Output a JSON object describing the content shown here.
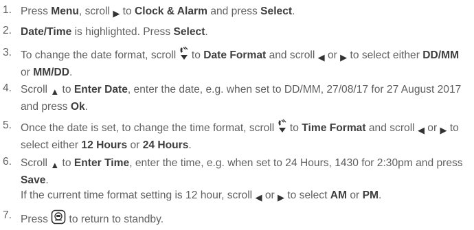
{
  "steps": [
    {
      "number": "1.",
      "parts": [
        {
          "t": "Press "
        },
        {
          "t": "Menu",
          "b": true
        },
        {
          "t": ", scroll "
        },
        {
          "icon": "right-arrow-icon",
          "g": "▶"
        },
        {
          "t": " to "
        },
        {
          "t": "Clock & Alarm",
          "b": true
        },
        {
          "t": " and press "
        },
        {
          "t": "Select",
          "b": true
        },
        {
          "t": "."
        }
      ]
    },
    {
      "number": "2.",
      "parts": [
        {
          "t": "Date/Time",
          "b": true
        },
        {
          "t": " is highlighted. Press "
        },
        {
          "t": "Select",
          "b": true
        },
        {
          "t": "."
        }
      ]
    },
    {
      "number": "3.",
      "parts": [
        {
          "t": "To change the date format, scroll "
        },
        {
          "icon": "phone-scroll-down-icon"
        },
        {
          "t": " to "
        },
        {
          "t": "Date Format",
          "b": true
        },
        {
          "t": " and scroll "
        },
        {
          "icon": "left-arrow-icon",
          "g": "◀"
        },
        {
          "t": " or "
        },
        {
          "icon": "right-arrow-icon",
          "g": "▶"
        },
        {
          "t": " to select either "
        },
        {
          "t": "DD/MM",
          "b": true
        },
        {
          "t": " or "
        },
        {
          "t": "MM/DD",
          "b": true
        },
        {
          "t": "."
        }
      ]
    },
    {
      "number": "4.",
      "parts": [
        {
          "t": "Scroll "
        },
        {
          "icon": "up-arrow-icon",
          "g": "▲"
        },
        {
          "t": " to "
        },
        {
          "t": "Enter Date",
          "b": true
        },
        {
          "t": ", enter the date, e.g. when set to DD/MM, 27/08/17 for 27 August 2017 and press "
        },
        {
          "t": "Ok",
          "b": true
        },
        {
          "t": "."
        }
      ]
    },
    {
      "number": "5.",
      "parts": [
        {
          "t": "Once the date is set, to change the time format, scroll "
        },
        {
          "icon": "phone-scroll-down-icon"
        },
        {
          "t": " to "
        },
        {
          "t": "Time Format",
          "b": true
        },
        {
          "t": " and scroll "
        },
        {
          "icon": "left-arrow-icon",
          "g": "◀"
        },
        {
          "t": " or "
        },
        {
          "icon": "right-arrow-icon",
          "g": "▶"
        },
        {
          "t": " to select either "
        },
        {
          "t": "12 Hours",
          "b": true
        },
        {
          "t": " or "
        },
        {
          "t": "24 Hours",
          "b": true
        },
        {
          "t": "."
        }
      ]
    },
    {
      "number": "6.",
      "parts": [
        {
          "t": "Scroll "
        },
        {
          "icon": "up-arrow-icon",
          "g": "▲"
        },
        {
          "t": " to "
        },
        {
          "t": "Enter Time",
          "b": true
        },
        {
          "t": ", enter the time, e.g. when set to 24 Hours, 1430 for 2:30pm and press "
        },
        {
          "t": "Save",
          "b": true
        },
        {
          "t": "."
        },
        {
          "br": true
        },
        {
          "t": "If the current time format setting is 12 hour, scroll "
        },
        {
          "icon": "left-arrow-icon",
          "g": "◀"
        },
        {
          "t": " or "
        },
        {
          "icon": "right-arrow-icon",
          "g": "▶"
        },
        {
          "t": " to select "
        },
        {
          "t": "AM",
          "b": true
        },
        {
          "t": " or "
        },
        {
          "t": "PM",
          "b": true
        },
        {
          "t": "."
        }
      ]
    },
    {
      "number": "7.",
      "parts": [
        {
          "t": "Press "
        },
        {
          "icon": "standby-button-icon"
        },
        {
          "t": " to return to standby."
        }
      ]
    }
  ]
}
